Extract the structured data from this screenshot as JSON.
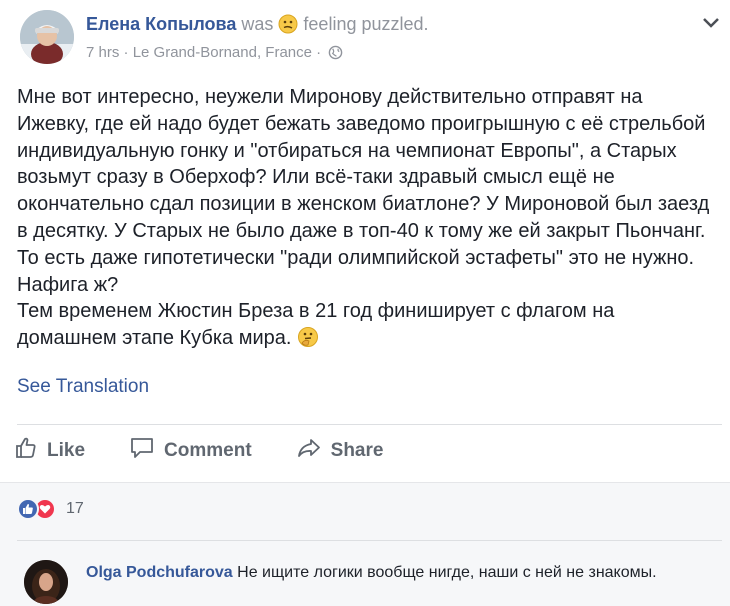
{
  "post": {
    "author": "Елена Копылова",
    "status_prefix": "was",
    "status_suffix": "feeling puzzled.",
    "time": "7 hrs",
    "separator": "·",
    "location": "Le Grand-Bornand, France",
    "paragraph1": "Мне вот интересно, неужели Миронову действительно отправят на Ижевку, где ей надо будет бежать заведомо проигрышную с её стрельбой индивидуальную гонку и \"отбираться на чемпионат Европы\", а Старых возьмут сразу в Оберхоф? Или всё-таки здравый смысл ещё не окончательно сдал позиции в женском биатлоне? У Мироновой был заезд в десятку. У Старых не было даже в топ-40 к тому же ей закрыт Пьончанг. То есть даже гипотетически \"ради олимпийской эстафеты\" это не нужно. Нафига ж?",
    "paragraph2": "Тем временем Жюстин Бреза в 21 год финиширует с флагом на домашнем этапе Кубка мира.",
    "see_translation": "See Translation"
  },
  "actions": {
    "like": "Like",
    "comment": "Comment",
    "share": "Share"
  },
  "reactions": {
    "count": "17"
  },
  "comment": {
    "author": "Olga Podchufarova",
    "text": "Не ищите логики вообще нигде, наши с ней не знакомы."
  },
  "icons": {
    "feeling": "puzzled-emoji-icon",
    "post_emoji": "thinking-emoji-icon",
    "privacy": "globe-icon",
    "menu": "chevron-down-icon",
    "like": "thumbs-up-icon",
    "comment": "speech-bubble-icon",
    "share": "share-arrow-icon",
    "reaction_like": "like-reaction-icon",
    "reaction_love": "love-reaction-icon"
  },
  "colors": {
    "link": "#365899",
    "muted": "#90949c",
    "text": "#1d2129",
    "action": "#606770",
    "like_blue": "#4267b2",
    "love_red": "#f0374f",
    "footer_bg": "#f6f7f9"
  }
}
